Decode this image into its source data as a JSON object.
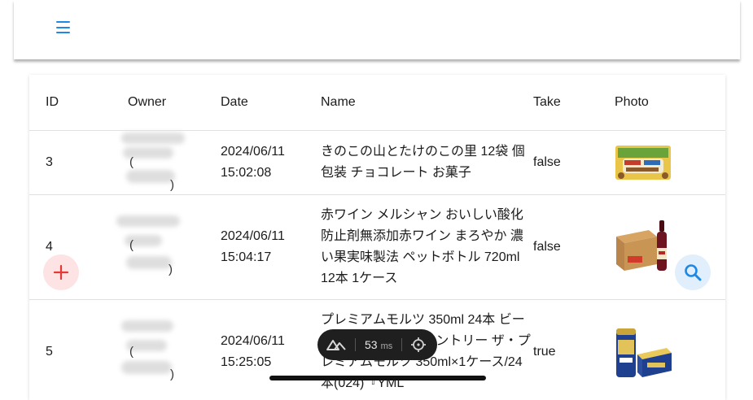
{
  "table": {
    "headers": {
      "id": "ID",
      "owner": "Owner",
      "date": "Date",
      "name": "Name",
      "take": "Take",
      "photo": "Photo"
    },
    "rows": [
      {
        "id": "3",
        "date_line1": "2024/06/11",
        "date_line2": "15:02:08",
        "name": "きのこの山とたけのこの里 12袋 個包装 チョコレート お菓子",
        "take": "false",
        "photo_icon": "chocolate-snack-bag"
      },
      {
        "id": "4",
        "date_line1": "2024/06/11",
        "date_line2": "15:04:17",
        "name": "赤ワイン メルシャン おいしい酸化防止剤無添加赤ワイン まろやか 濃い果実味製法 ペットボトル 720ml 12本 1ケース",
        "take": "false",
        "photo_icon": "wine-bottle-and-box"
      },
      {
        "id": "5",
        "date_line1": "2024/06/11",
        "date_line2": "15:25:05",
        "name": "プレミアムモルツ 350ml 24本 ビール beer 送料無料 サントリー ザ・プレミアムモルツ 350ml×1ケース/24本(024)『YML",
        "take": "true",
        "photo_icon": "beer-can-and-case"
      }
    ]
  },
  "perf": {
    "value": "53",
    "unit": "ms"
  },
  "colors": {
    "accent": "#1e88e5",
    "add": "#e53935"
  },
  "icons": {
    "menu": "menu-icon",
    "add": "plus-icon",
    "search": "search-icon"
  }
}
